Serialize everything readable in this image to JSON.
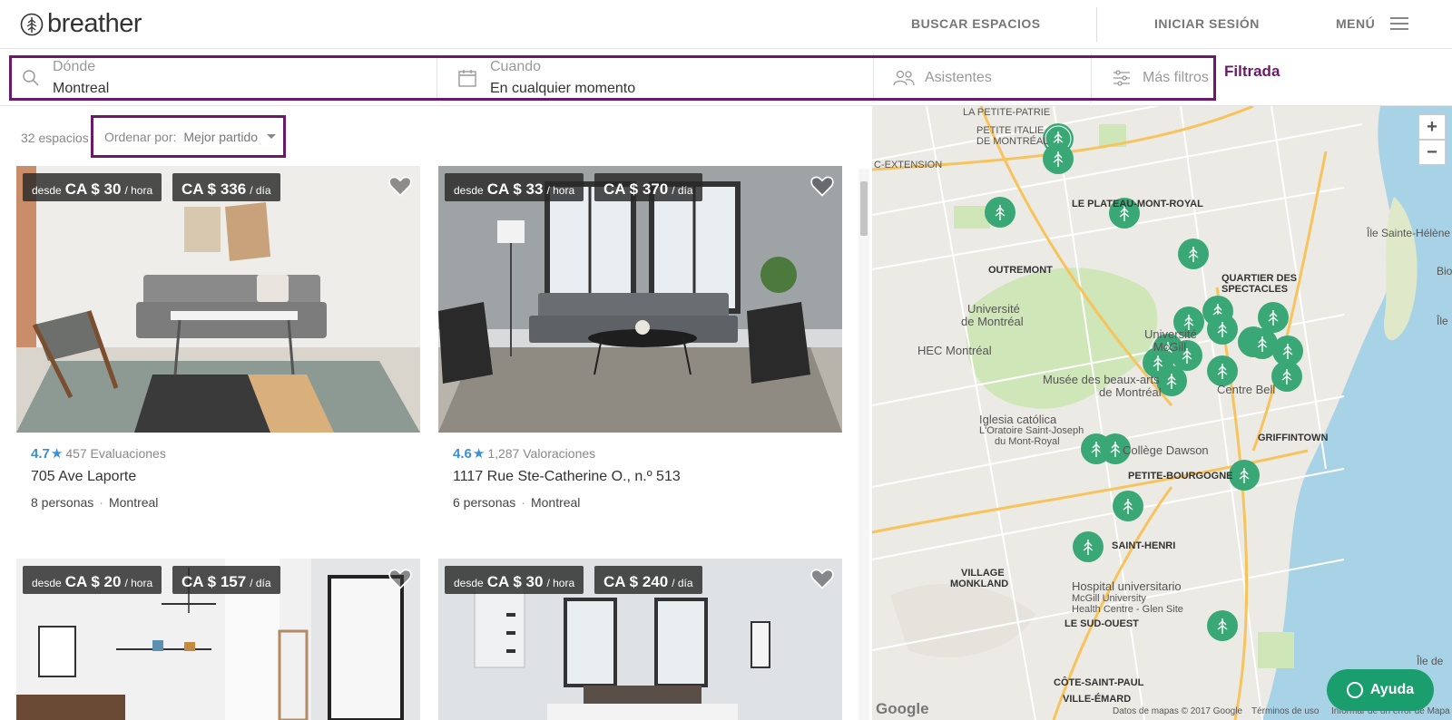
{
  "brand": {
    "name": "breather"
  },
  "nav": {
    "search_spaces": "BUSCAR ESPACIOS",
    "login": "INICIAR SESIÓN",
    "menu": "MENÚ"
  },
  "filters": {
    "where_label": "Dónde",
    "where_value": "Montreal",
    "when_label": "Cuando",
    "when_value": "En cualquier momento",
    "attendees": "Asistentes",
    "more_filters": "Más filtros",
    "status": "Filtrada"
  },
  "results": {
    "count": "32 espacios",
    "sort_label": "Ordenar por:",
    "sort_value": "Mejor partido"
  },
  "listings": [
    {
      "from": "desde",
      "hour_price": "CA $ 30",
      "hour_unit": "/ hora",
      "day_price": "CA $ 336",
      "day_unit": "/ día",
      "rating": "4.7",
      "reviews": "457 Evaluaciones",
      "address": "705 Ave Laporte",
      "capacity": "8 personas",
      "city": "Montreal"
    },
    {
      "from": "desde",
      "hour_price": "CA $ 33",
      "hour_unit": "/ hora",
      "day_price": "CA $ 370",
      "day_unit": "/ día",
      "rating": "4.6",
      "reviews": "1,287 Valoraciones",
      "address": "1117 Rue Ste-Catherine O., n.º 513",
      "capacity": "6 personas",
      "city": "Montreal"
    },
    {
      "from": "desde",
      "hour_price": "CA $ 20",
      "hour_unit": "/ hora",
      "day_price": "CA $ 157",
      "day_unit": "/ día"
    },
    {
      "from": "desde",
      "hour_price": "CA $ 30",
      "hour_unit": "/ hora",
      "day_price": "CA $ 240",
      "day_unit": "/ día"
    }
  ],
  "map": {
    "zoom_in": "+",
    "zoom_out": "−",
    "labels": {
      "petite_patrie": "LA PETITE-PATRIE",
      "petite_italie": "PETITE ITALIE",
      "de_montreal": "DE MONTRÉAL",
      "c_extension": "C-EXTENSION",
      "plateau": "LE PLATEAU-MONT-ROYAL",
      "outremont": "OUTREMONT",
      "quartier": "QUARTIER DES",
      "spectacles": "SPECTACLES",
      "udem1": "Université",
      "udem2": "de Montréal",
      "hec": "HEC Montréal",
      "mcgill1": "Université",
      "mcgill2": "McGill",
      "beaux_arts1": "Musée des beaux-arts",
      "beaux_arts2": "de Montréal",
      "centre_bell": "Centre Bell",
      "iglesia1": "Iglesia católica",
      "iglesia2": "L'Oratoire Saint-Joseph",
      "iglesia3": "du Mont-Royal",
      "griffintown": "GRIFFINTOWN",
      "dawson": "Collège Dawson",
      "petite_bourgogne": "PETITE-BOURGOGNE",
      "saint_henri": "SAINT-HENRI",
      "village1": "VILLAGE",
      "village2": "MONKLAND",
      "hospital1": "Hospital universitario",
      "hospital2": "McGill University",
      "hospital3": "Health Centre - Glen Site",
      "sud_ouest": "LE SUD-OUEST",
      "cote_st_paul": "CÔTE-SAINT-PAUL",
      "ville_emard": "VILLE-ÉMARD",
      "ile_ste_helene": "Île Sainte-Hélène",
      "bio": "Bio",
      "ile": "Île",
      "ile_de": "Île de"
    },
    "footer": {
      "data": "Datos de mapas © 2017 Google",
      "terms": "Términos de uso",
      "report": "Informar de un error de Mapa"
    },
    "google": "Google"
  },
  "help": {
    "label": "Ayuda"
  },
  "colors": {
    "accent": "#6b1a6b",
    "pin": "#3aa776",
    "rating": "#3a8fd8",
    "help": "#1a9e6e"
  }
}
